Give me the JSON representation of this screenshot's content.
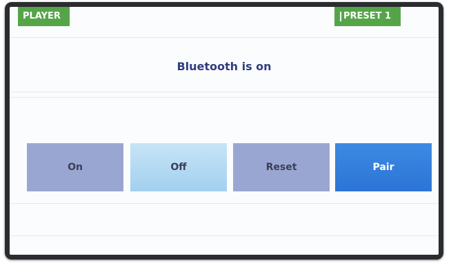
{
  "header": {
    "left_tab": "PLAYER",
    "right_tab": "PRESET 1"
  },
  "status": {
    "text": "Bluetooth is on"
  },
  "buttons": {
    "on": "On",
    "off": "Off",
    "reset": "Reset",
    "pair": "Pair"
  },
  "colors": {
    "tab_green": "#55a548",
    "status_text": "#2e3e7e",
    "button_default": "#9aa6d2",
    "button_off": "#a3d0ef",
    "button_pair": "#2c74d6",
    "bezel": "#2a2c30"
  }
}
